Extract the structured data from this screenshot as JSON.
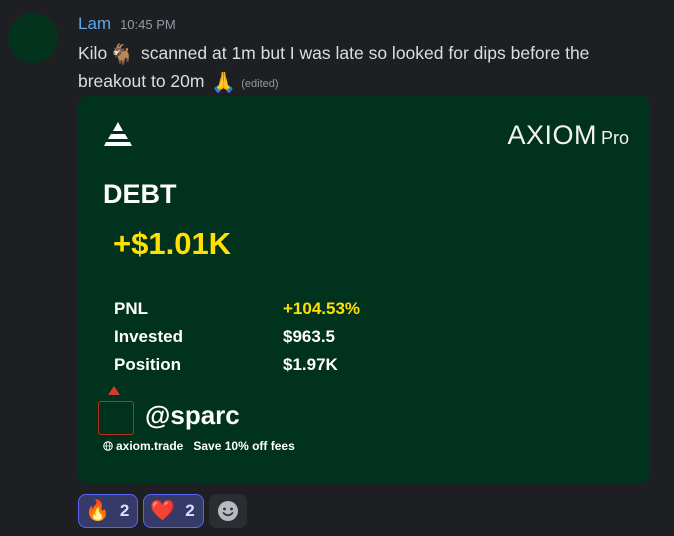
{
  "message": {
    "username": "Lam",
    "timestamp": "10:45 PM",
    "text_part1": "Kilo",
    "emoji_goat": "🐐",
    "text_part2": " scanned at 1m but I was late so looked for dips before the breakout to 20m",
    "emoji_pray": "🙏",
    "edited": "(edited)"
  },
  "card": {
    "brand_main": "AXIOM",
    "brand_sub": "Pro",
    "ticker": "DEBT",
    "profit": "+$1.01K",
    "stats": [
      {
        "label": "PNL",
        "value": "+104.53%"
      },
      {
        "label": "Invested",
        "value": "$963.5"
      },
      {
        "label": "Position",
        "value": "$1.97K"
      }
    ],
    "handle": "@sparc",
    "site": "axiom.trade",
    "promo": "Save 10% off fees"
  },
  "reactions": [
    {
      "emoji": "🔥",
      "count": "2"
    },
    {
      "emoji": "❤️",
      "count": "2"
    }
  ],
  "colors": {
    "background": "#1e1f22",
    "username": "#5fa8ee",
    "card_bg": "#00321d",
    "accent_yellow": "#ffe000",
    "reaction_border": "#5865f2"
  }
}
